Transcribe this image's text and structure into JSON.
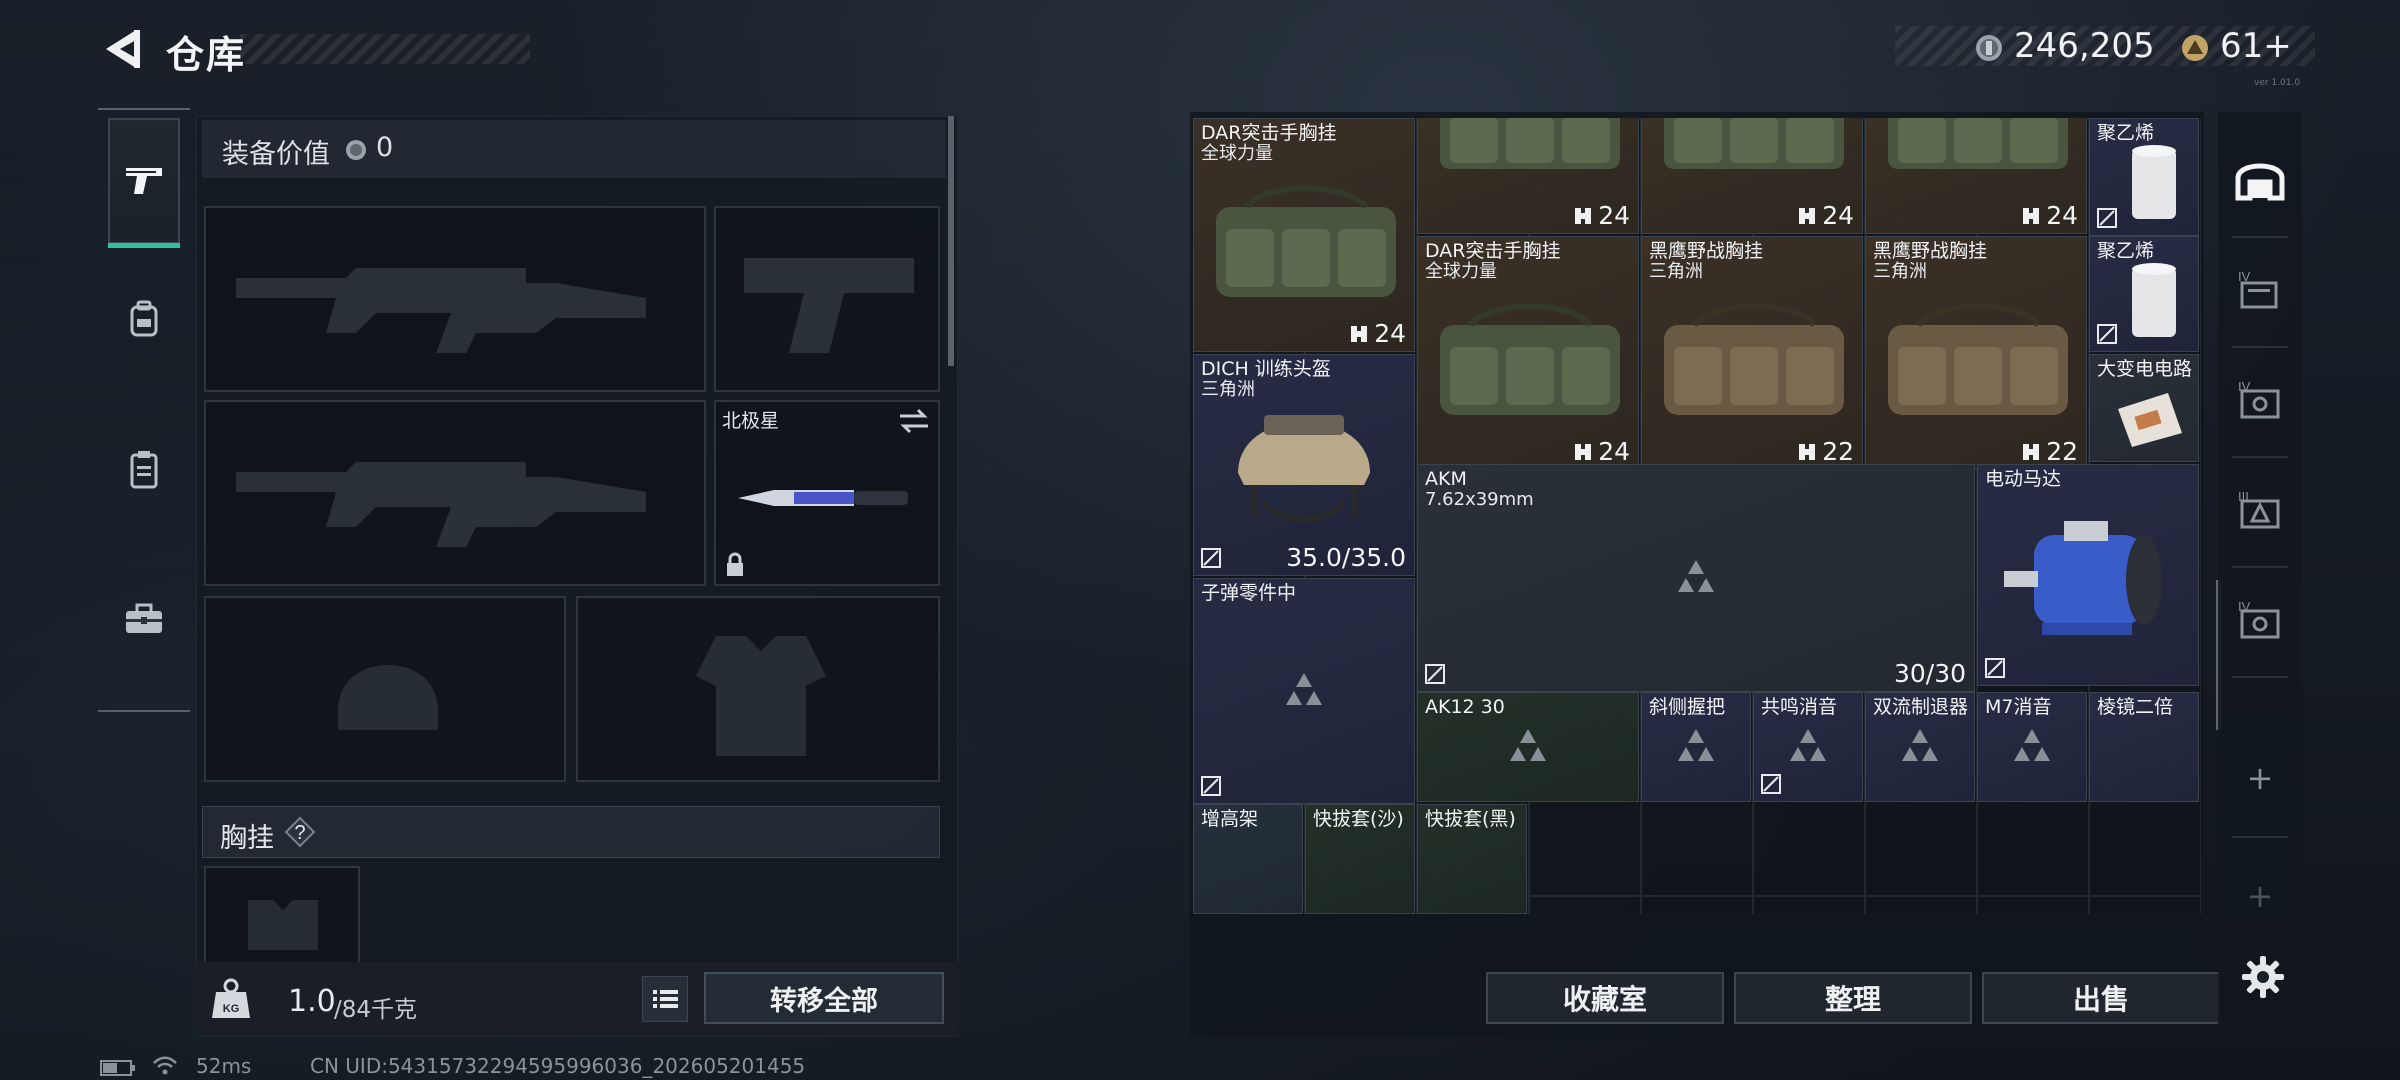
{
  "header": {
    "title": "仓库",
    "currency_coin": "246,205",
    "currency_token": "61+",
    "version_tiny": "ver 1.01.0"
  },
  "colors": {
    "accent": "#2ec4a0",
    "panel": "#141a21",
    "brown_bg": "#3a3026",
    "navy_bg": "#272c45"
  },
  "left_nav": {
    "items": [
      {
        "icon": "pistol-icon",
        "active": true
      },
      {
        "icon": "backpack-icon",
        "active": false
      },
      {
        "icon": "clipboard-icon",
        "active": false
      },
      {
        "icon": "toolbox-icon",
        "active": false
      }
    ]
  },
  "loadout": {
    "value_label": "装备价值",
    "value_amount": "0",
    "melee_name": "北极星",
    "chest_rig_label": "胸挂",
    "chest_rig_help": "?",
    "weight_current": "1.0",
    "weight_max": "/84千克",
    "kg_badge": "KG",
    "transfer_all_label": "转移全部",
    "slot_icons": [
      "rifle-silhouette-icon",
      "pistol-silhouette-icon",
      "rifle-silhouette-icon",
      "knife-icon",
      "helmet-silhouette-icon",
      "armor-silhouette-icon",
      "chest-rig-silhouette-icon"
    ]
  },
  "storage": {
    "items": [
      {
        "id": "dar-rig-1",
        "name": "DAR突击手胸挂",
        "sub": "全球力量",
        "durability": "24",
        "color": "brown"
      },
      {
        "id": "rig-top-1",
        "name": "",
        "sub": "",
        "durability": "24",
        "color": "brown"
      },
      {
        "id": "rig-top-2",
        "name": "",
        "sub": "",
        "durability": "24",
        "color": "brown"
      },
      {
        "id": "rig-top-3",
        "name": "",
        "sub": "",
        "durability": "24",
        "color": "brown"
      },
      {
        "id": "poly-1",
        "name": "聚乙烯",
        "sub": "",
        "durability": "",
        "color": "navy"
      },
      {
        "id": "dar-rig-2",
        "name": "DAR突击手胸挂",
        "sub": "全球力量",
        "durability": "24",
        "color": "brown"
      },
      {
        "id": "blackhawk-1",
        "name": "黑鹰野战胸挂",
        "sub": "三角洲",
        "durability": "22",
        "color": "brown"
      },
      {
        "id": "blackhawk-2",
        "name": "黑鹰野战胸挂",
        "sub": "三角洲",
        "durability": "22",
        "color": "brown"
      },
      {
        "id": "poly-2",
        "name": "聚乙烯",
        "sub": "",
        "durability": "",
        "color": "navy"
      },
      {
        "id": "dich-helmet",
        "name": "DICH 训练头盔",
        "sub": "三角洲",
        "durability": "35.0/35.0",
        "color": "navy"
      },
      {
        "id": "transformer",
        "name": "大变电电路",
        "sub": "",
        "durability": "",
        "color": "slate"
      },
      {
        "id": "akm",
        "name": "AKM",
        "sub": "7.62x39mm",
        "durability": "30/30",
        "color": "slate"
      },
      {
        "id": "motor",
        "name": "电动马达",
        "sub": "",
        "durability": "",
        "color": "navy"
      },
      {
        "id": "ammo-parts",
        "name": "子弹零件中",
        "sub": "",
        "durability": "",
        "color": "navy"
      },
      {
        "id": "ak12",
        "name": "AK12 30",
        "sub": "",
        "durability": "",
        "color": "green"
      },
      {
        "id": "angled-grip",
        "name": "斜侧握把",
        "sub": "",
        "durability": "",
        "color": "navy"
      },
      {
        "id": "resonance",
        "name": "共鸣消音",
        "sub": "",
        "durability": "",
        "color": "navy"
      },
      {
        "id": "dual-brake",
        "name": "双流制退器",
        "sub": "",
        "durability": "",
        "color": "navy"
      },
      {
        "id": "m7-suppressor",
        "name": "M7消音",
        "sub": "",
        "durability": "",
        "color": "navy"
      },
      {
        "id": "prism-2x",
        "name": "棱镜二倍",
        "sub": "",
        "durability": "",
        "color": "navy"
      },
      {
        "id": "riser",
        "name": "增高架",
        "sub": "",
        "durability": "",
        "color": "blueg"
      },
      {
        "id": "holster-sand",
        "name": "快拔套(沙)",
        "sub": "",
        "durability": "",
        "color": "green"
      },
      {
        "id": "holster-black",
        "name": "快拔套(黑)",
        "sub": "",
        "durability": "",
        "color": "green"
      }
    ],
    "buttons": {
      "collection": "收藏室",
      "sort": "整理",
      "sell": "出售"
    }
  },
  "right_tabs": [
    {
      "icon": "vault-icon",
      "label": ""
    },
    {
      "icon": "stash-tab-iv-icon",
      "label": "IV"
    },
    {
      "icon": "stash-tab-iv-image-icon",
      "label": "IV"
    },
    {
      "icon": "stash-tab-iii-icon",
      "label": "III"
    },
    {
      "icon": "stash-tab-iv-image2-icon",
      "label": "IV"
    },
    {
      "icon": "add-tab-icon",
      "label": "+"
    },
    {
      "icon": "add-tab-icon",
      "label": "+"
    }
  ],
  "status": {
    "ping": "52ms",
    "uid": "CN UID:5431573229459599603​6_202605201455"
  }
}
